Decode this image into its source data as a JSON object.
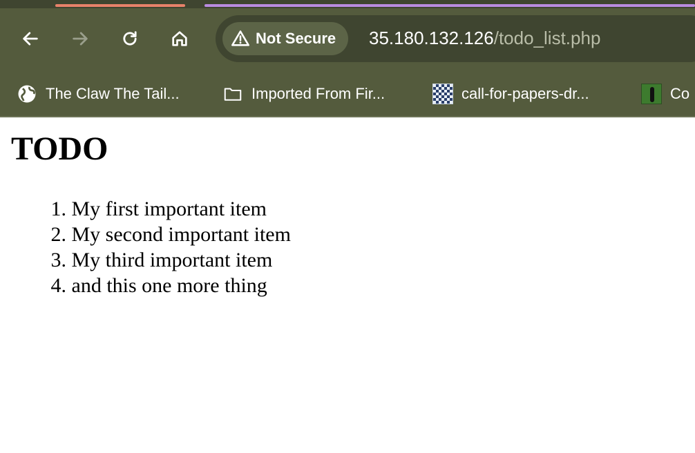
{
  "browser": {
    "security_label": "Not Secure",
    "url_host": "35.180.132.126",
    "url_path": "/todo_list.php",
    "colors": {
      "toolbar": "#545b3d",
      "omnibox": "#3f4530",
      "tab_accent_1": "#e8826a",
      "tab_accent_2": "#b98be0"
    },
    "nav_icons": [
      "back-arrow-icon",
      "forward-arrow-icon",
      "reload-icon",
      "home-icon"
    ]
  },
  "bookmarks": [
    {
      "label": "The Claw The Tail...",
      "icon": "globe-icon"
    },
    {
      "label": "Imported From Fir...",
      "icon": "folder-icon"
    },
    {
      "label": "call-for-papers-dr...",
      "icon": "grid-favicon"
    },
    {
      "label": "Co",
      "icon": "person-favicon"
    }
  ],
  "page": {
    "title": "TODO",
    "items": [
      {
        "num": "1.",
        "text": "My first important item"
      },
      {
        "num": "2.",
        "text": "My second important item"
      },
      {
        "num": "3.",
        "text": "My third important item"
      },
      {
        "num": "4.",
        "text": "and this one more thing"
      }
    ]
  }
}
